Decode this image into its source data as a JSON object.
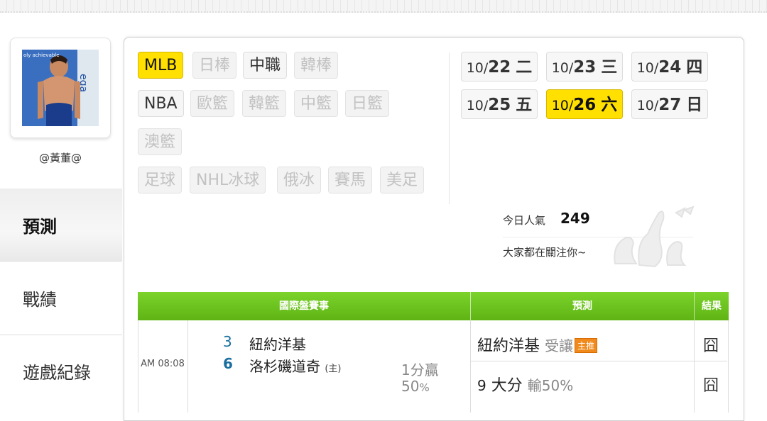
{
  "profile": {
    "username": "@黃董@"
  },
  "sidebar": {
    "items": [
      {
        "label": "預測"
      },
      {
        "label": "戰績"
      },
      {
        "label": "遊戲紀錄"
      }
    ]
  },
  "leagues": [
    {
      "label": "MLB",
      "state": "active"
    },
    {
      "label": "日棒",
      "state": "disabled"
    },
    {
      "label": "中職",
      "state": "enabled"
    },
    {
      "label": "韓棒",
      "state": "disabled"
    },
    {
      "label": "NBA",
      "state": "enabled"
    },
    {
      "label": "歐籃",
      "state": "disabled"
    },
    {
      "label": "韓籃",
      "state": "disabled"
    },
    {
      "label": "中籃",
      "state": "disabled"
    },
    {
      "label": "日籃",
      "state": "disabled"
    },
    {
      "label": "澳籃",
      "state": "disabled"
    },
    {
      "label": "足球",
      "state": "disabled"
    },
    {
      "label": "NHL冰球",
      "state": "disabled"
    },
    {
      "label": "俄冰",
      "state": "disabled"
    },
    {
      "label": "賽馬",
      "state": "disabled"
    },
    {
      "label": "美足",
      "state": "disabled"
    }
  ],
  "dates": [
    {
      "month": "10/",
      "day": "22",
      "weekday": "二",
      "active": false
    },
    {
      "month": "10/",
      "day": "23",
      "weekday": "三",
      "active": false
    },
    {
      "month": "10/",
      "day": "24",
      "weekday": "四",
      "active": false
    },
    {
      "month": "10/",
      "day": "25",
      "weekday": "五",
      "active": false
    },
    {
      "month": "10/",
      "day": "26",
      "weekday": "六",
      "active": true
    },
    {
      "month": "10/",
      "day": "27",
      "weekday": "日",
      "active": false
    }
  ],
  "popularity": {
    "label": "今日人氣",
    "count": "249",
    "message": "大家都在關注你~"
  },
  "table": {
    "headers": {
      "event": "國際盤賽事",
      "prediction": "預測",
      "result": "結果"
    },
    "game": {
      "time": "AM 08:08",
      "away": {
        "score": "3",
        "team": "紐約洋基"
      },
      "home": {
        "score": "6",
        "team": "洛杉磯道奇",
        "mark": "(主)"
      },
      "odds_line1": "1分贏",
      "odds_line2_num": "50",
      "odds_line2_unit": "%"
    },
    "predictions": [
      {
        "team": "紐約洋基",
        "sub": "受讓",
        "badge": "主推",
        "result": "囧"
      },
      {
        "num": "9",
        "pick": "大分",
        "sub": "輸50%",
        "result": "囧"
      }
    ]
  },
  "colors": {
    "accent_yellow": "#ffe000",
    "header_green": "#68c01e",
    "score_blue": "#1a6f9e",
    "badge_orange": "#f08a1c"
  }
}
